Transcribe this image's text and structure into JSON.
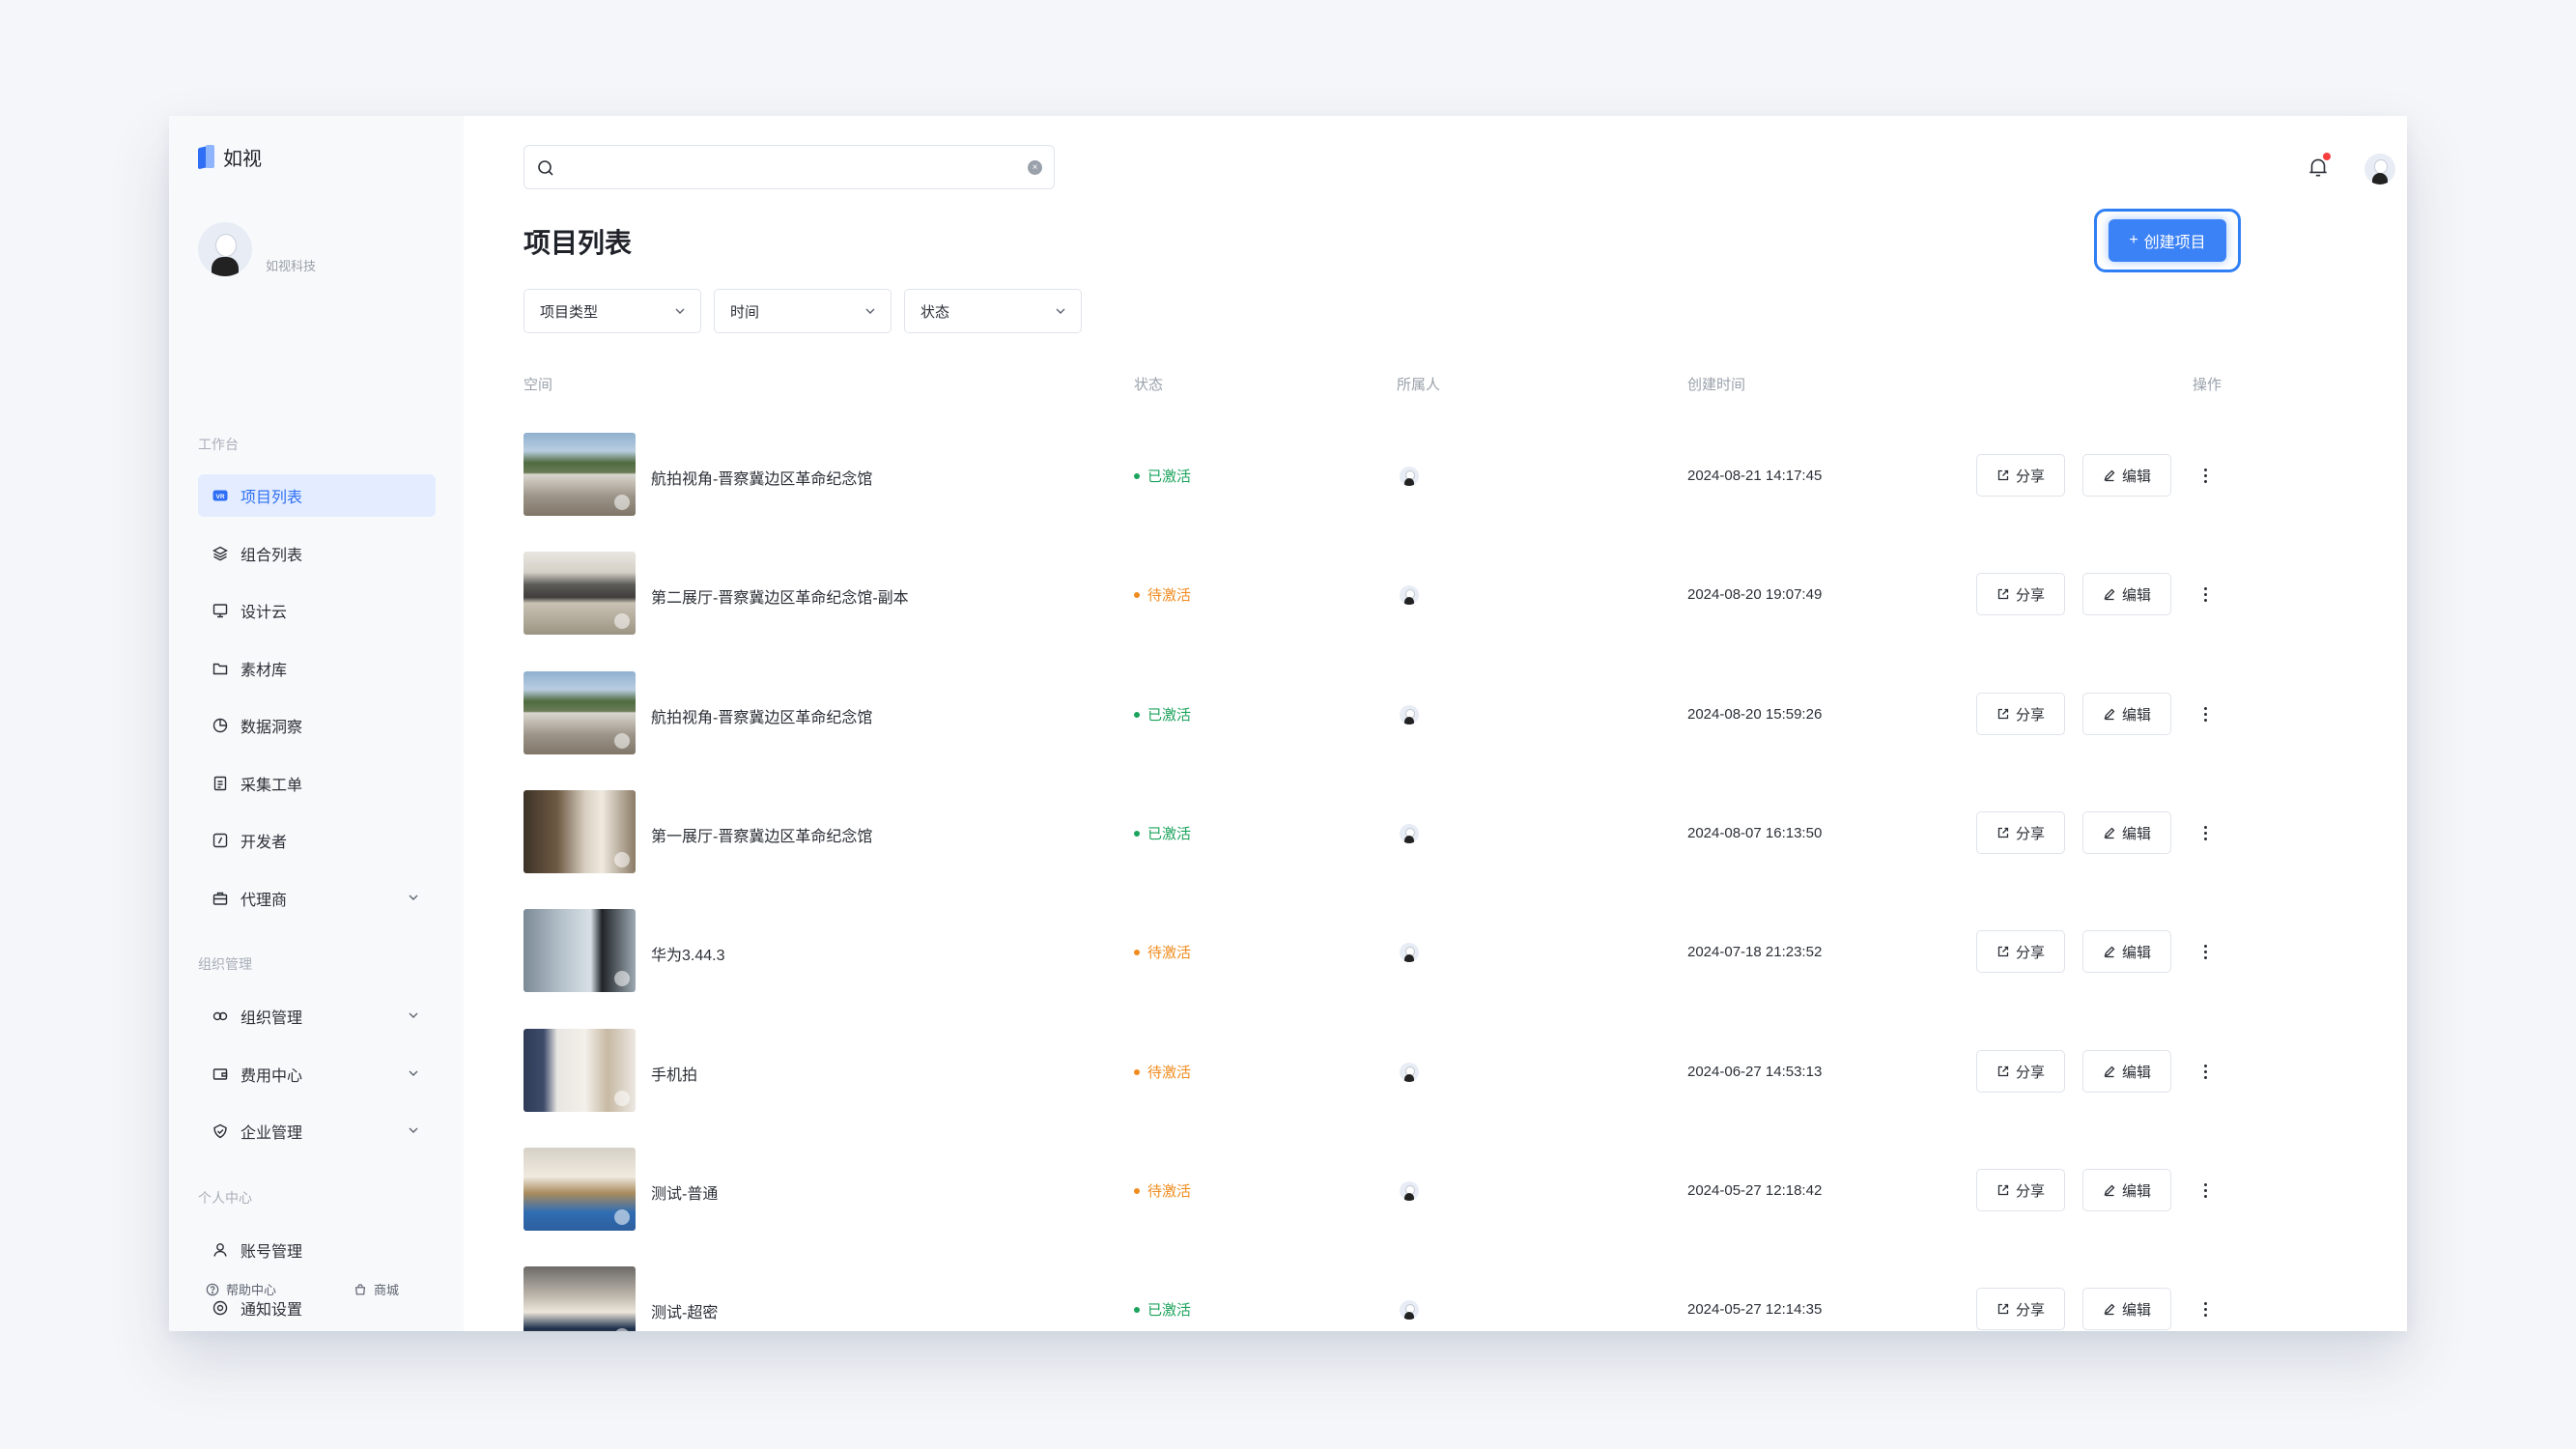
{
  "app": {
    "name": "如视"
  },
  "profile": {
    "name": "如视科技"
  },
  "sidebar": {
    "sections": [
      {
        "title": "工作台",
        "items": [
          {
            "label": "项目列表",
            "icon": "vr-icon",
            "active": true
          },
          {
            "label": "组合列表",
            "icon": "layers-icon"
          },
          {
            "label": "设计云",
            "icon": "monitor-icon"
          },
          {
            "label": "素材库",
            "icon": "folder-icon"
          },
          {
            "label": "数据洞察",
            "icon": "pie-chart-icon"
          },
          {
            "label": "采集工单",
            "icon": "clipboard-icon"
          },
          {
            "label": "开发者",
            "icon": "code-icon"
          },
          {
            "label": "代理商",
            "icon": "briefcase-icon",
            "expandable": true
          }
        ]
      },
      {
        "title": "组织管理",
        "items": [
          {
            "label": "组织管理",
            "icon": "organization-icon",
            "expandable": true
          },
          {
            "label": "费用中心",
            "icon": "wallet-icon",
            "expandable": true
          },
          {
            "label": "企业管理",
            "icon": "shield-icon",
            "expandable": true
          }
        ]
      },
      {
        "title": "个人中心",
        "items": [
          {
            "label": "账号管理",
            "icon": "user-icon"
          },
          {
            "label": "通知设置",
            "icon": "settings-icon"
          }
        ]
      }
    ],
    "footer": {
      "help": "帮助中心",
      "store": "商城"
    }
  },
  "header": {
    "search": {
      "value": "",
      "placeholder": ""
    },
    "has_notification": true
  },
  "page": {
    "title": "项目列表",
    "create_button": "创建项目",
    "filters": [
      "项目类型",
      "时间",
      "状态"
    ]
  },
  "table": {
    "columns": {
      "space": "空间",
      "status": "状态",
      "owner": "所属人",
      "created": "创建时间",
      "actions": "操作"
    },
    "share_label": "分享",
    "edit_label": "编辑",
    "rows": [
      {
        "name": "航拍视角-晋察冀边区革命纪念馆",
        "status": "已激活",
        "status_type": "active",
        "created": "2024-08-21 14:17:45",
        "thumb": "aerial"
      },
      {
        "name": "第二展厅-晋察冀边区革命纪念馆-副本",
        "status": "待激活",
        "status_type": "pending",
        "created": "2024-08-20 19:07:49",
        "thumb": "hall2"
      },
      {
        "name": "航拍视角-晋察冀边区革命纪念馆",
        "status": "已激活",
        "status_type": "active",
        "created": "2024-08-20 15:59:26",
        "thumb": "aerial"
      },
      {
        "name": "第一展厅-晋察冀边区革命纪念馆",
        "status": "已激活",
        "status_type": "active",
        "created": "2024-08-07 16:13:50",
        "thumb": "hall1"
      },
      {
        "name": "华为3.44.3",
        "status": "待激活",
        "status_type": "pending",
        "created": "2024-07-18 21:23:52",
        "thumb": "office"
      },
      {
        "name": "手机拍",
        "status": "待激活",
        "status_type": "pending",
        "created": "2024-06-27 14:53:13",
        "thumb": "corridor"
      },
      {
        "name": "测试-普通",
        "status": "待激活",
        "status_type": "pending",
        "created": "2024-05-27 12:18:42",
        "thumb": "lobby"
      },
      {
        "name": "测试-超密",
        "status": "已激活",
        "status_type": "active",
        "created": "2024-05-27 12:14:35",
        "thumb": "room"
      }
    ]
  },
  "colors": {
    "accent": "#2f6ff5",
    "active": "#1ba35b",
    "pending": "#f08c1f"
  }
}
